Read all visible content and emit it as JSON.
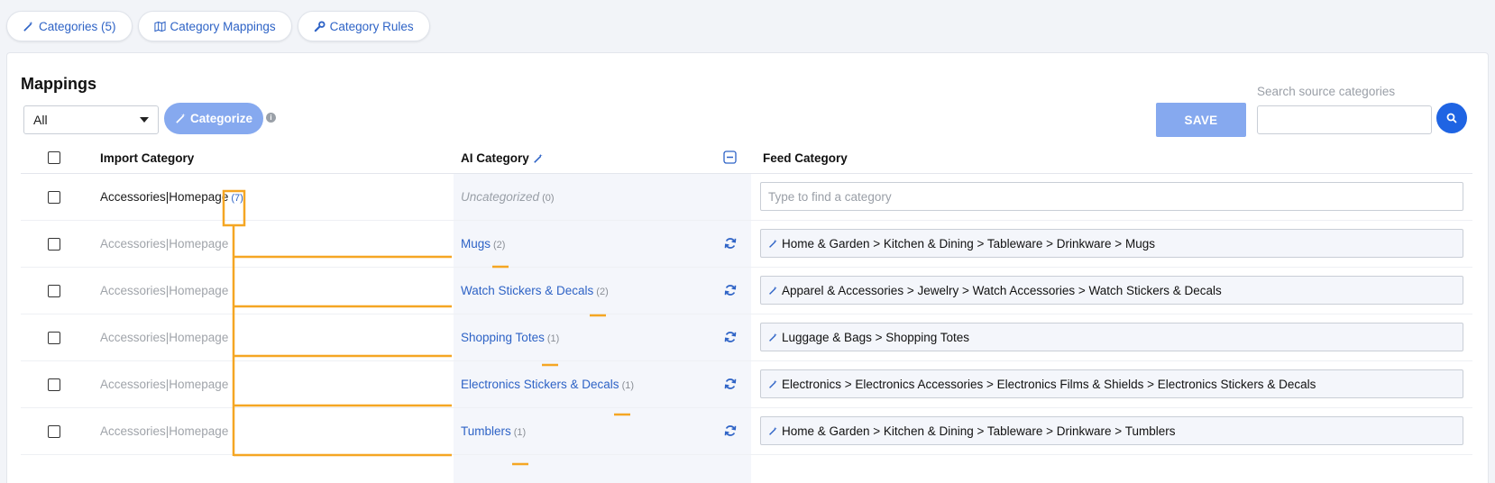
{
  "tabs": [
    {
      "label": "Categories (5)",
      "icon": "magic-wand-icon"
    },
    {
      "label": "Category Mappings",
      "icon": "map-icon"
    },
    {
      "label": "Category Rules",
      "icon": "wrench-icon"
    }
  ],
  "mappings": {
    "title": "Mappings",
    "filter_value": "All",
    "categorize_label": "Categorize",
    "save_label": "SAVE",
    "search_label": "Search source categories",
    "search_value": ""
  },
  "table": {
    "headers": {
      "import": "Import Category",
      "ai": "AI Category",
      "feed": "Feed Category"
    },
    "parent_row": {
      "import": "Accessories|Homepage",
      "import_count": "(7)",
      "ai": "Uncategorized",
      "ai_count": "(0)",
      "feed_placeholder": "Type to find a category"
    },
    "rows": [
      {
        "import": "Accessories|Homepage",
        "ai": "Mugs",
        "ai_count": "(2)",
        "feed": "Home & Garden > Kitchen & Dining > Tableware > Drinkware > Mugs"
      },
      {
        "import": "Accessories|Homepage",
        "ai": "Watch Stickers & Decals",
        "ai_count": "(2)",
        "feed": "Apparel & Accessories > Jewelry > Watch Accessories > Watch Stickers & Decals"
      },
      {
        "import": "Accessories|Homepage",
        "ai": "Shopping Totes",
        "ai_count": "(1)",
        "feed": "Luggage & Bags > Shopping Totes"
      },
      {
        "import": "Accessories|Homepage",
        "ai": "Electronics Stickers & Decals",
        "ai_count": "(1)",
        "feed": "Electronics > Electronics Accessories > Electronics Films & Shields > Electronics Stickers & Decals"
      },
      {
        "import": "Accessories|Homepage",
        "ai": "Tumblers",
        "ai_count": "(1)",
        "feed": "Home & Garden > Kitchen & Dining > Tableware > Drinkware > Tumblers"
      }
    ]
  },
  "colors": {
    "accent": "#2e63c6",
    "button": "#86a9ef",
    "annotation": "#f5a623"
  }
}
